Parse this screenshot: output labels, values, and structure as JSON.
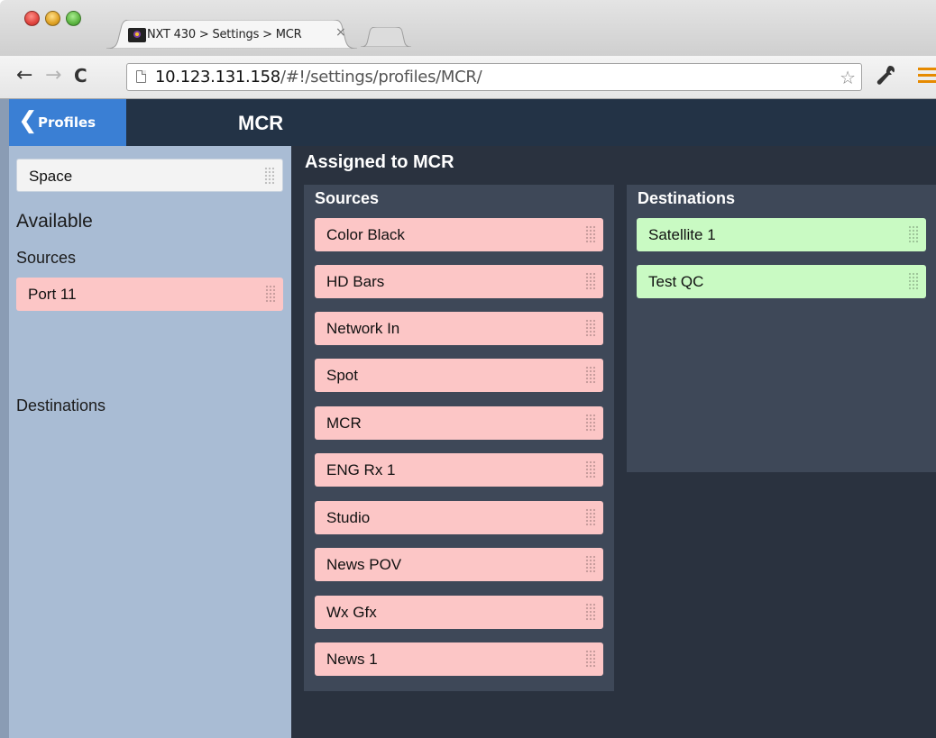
{
  "browser": {
    "tab_title": "NXT 430 > Settings > MCR",
    "tab_close": "×",
    "url_host": "10.123.131.158",
    "url_path": "/#!/settings/profiles/MCR/",
    "nav": {
      "back": "←",
      "forward": "→",
      "reload": "C"
    },
    "star": "☆"
  },
  "header": {
    "back_label": "Profiles",
    "back_chevron": "❮",
    "title": "MCR"
  },
  "sidebar": {
    "search_value": "Space",
    "available_label": "Available",
    "sources_label": "Sources",
    "sources": [
      "Port 11"
    ],
    "destinations_label": "Destinations",
    "destinations": []
  },
  "assigned": {
    "title": "Assigned to MCR",
    "sources_label": "Sources",
    "sources": [
      "Color Black",
      "HD Bars",
      "Network In",
      "Spot",
      "MCR",
      "ENG Rx 1",
      "Studio",
      "News POV",
      "Wx Gfx",
      "News 1"
    ],
    "destinations_label": "Destinations",
    "destinations": [
      "Satellite 1",
      "Test QC"
    ]
  },
  "colors": {
    "source_item": "#fcc6c6",
    "destination_item": "#c9fac3",
    "header_bg": "#233346",
    "back_button": "#3a7fd4",
    "sidebar_bg": "#a9bcd4",
    "main_bg": "#2a323f",
    "panel_bg": "#3e4858"
  }
}
